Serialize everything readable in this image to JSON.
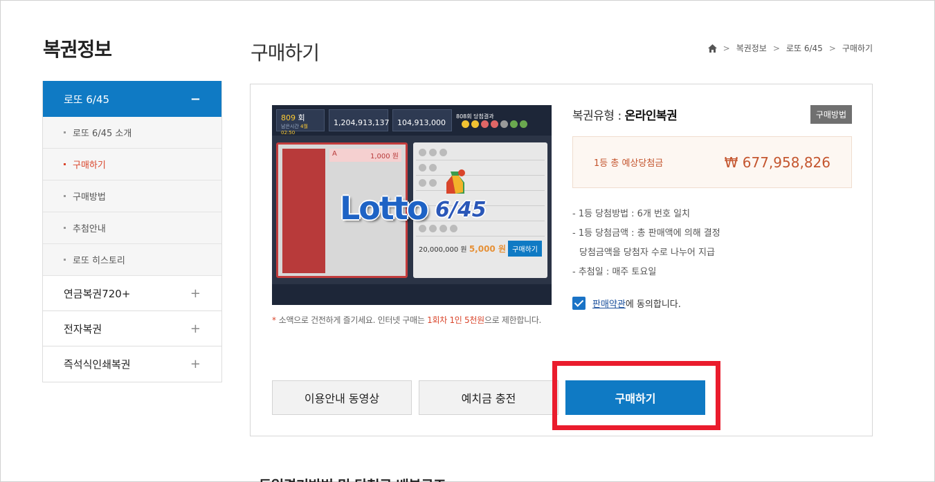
{
  "sidebar": {
    "title": "복권정보",
    "active": {
      "label": "로또 6/45",
      "toggle": "−"
    },
    "sub_items": [
      {
        "label": "로또 6/45 소개",
        "current": false
      },
      {
        "label": "구매하기",
        "current": true
      },
      {
        "label": "구매방법",
        "current": false
      },
      {
        "label": "추첨안내",
        "current": false
      },
      {
        "label": "로또 히스토리",
        "current": false
      }
    ],
    "items": [
      {
        "label": "연금복권720+",
        "toggle": "+"
      },
      {
        "label": "전자복권",
        "toggle": "+"
      },
      {
        "label": "즉석식인쇄복권",
        "toggle": "+"
      }
    ]
  },
  "header": {
    "title": "구매하기",
    "breadcrumb": [
      "복권정보",
      "로또 6/45",
      "구매하기"
    ],
    "breadcrumb_sep": ">"
  },
  "game_image": {
    "round": "809",
    "round_unit": "회",
    "remaining_label": "남은시간",
    "remaining_day": "4월 02:50",
    "pot_amount": "1,204,913,137",
    "sales_amount": "104,913,000",
    "result_label": "808회 당첨결과",
    "slip_letter": "A",
    "slip_amount": "1,000 원",
    "deposit": "20,000,000 원",
    "total": "5,000 원",
    "buy": "구매하기",
    "logo_text": "Lotto",
    "logo_num": "6/45"
  },
  "notice": {
    "asterisk": "*",
    "text_before": "소액으로 건전하게 즐기세요. 인터넷 구매는 ",
    "text_highlight": "1회차 1인 5천원",
    "text_after": "으로 제한합니다."
  },
  "info": {
    "type_prefix": "복권유형 : ",
    "type_value": "온라인복권",
    "howto_button": "구매방법",
    "prize_label": "1등 총 예상당첨금",
    "prize_amount": "₩ 677,958,826",
    "list": [
      "- 1등 당첨방법 : 6개 번호 일치",
      "- 1등 당첨금액 : 총 판매액에 의해 결정",
      "당첨금액을 당첨자 수로 나누어 지급",
      "- 추첨일 : 매주 토요일"
    ],
    "agree_link": "판매약관",
    "agree_text": "에 동의합니다."
  },
  "buttons": {
    "video": "이용안내 동영상",
    "charge": "예치금 충전",
    "buy": "구매하기"
  },
  "bottom_heading": "동일경기방법 및 당첨금 배분구조",
  "colors": {
    "primary": "#0f7ac4",
    "accent_red": "#d9452b",
    "highlight": "#ea1c2d"
  }
}
